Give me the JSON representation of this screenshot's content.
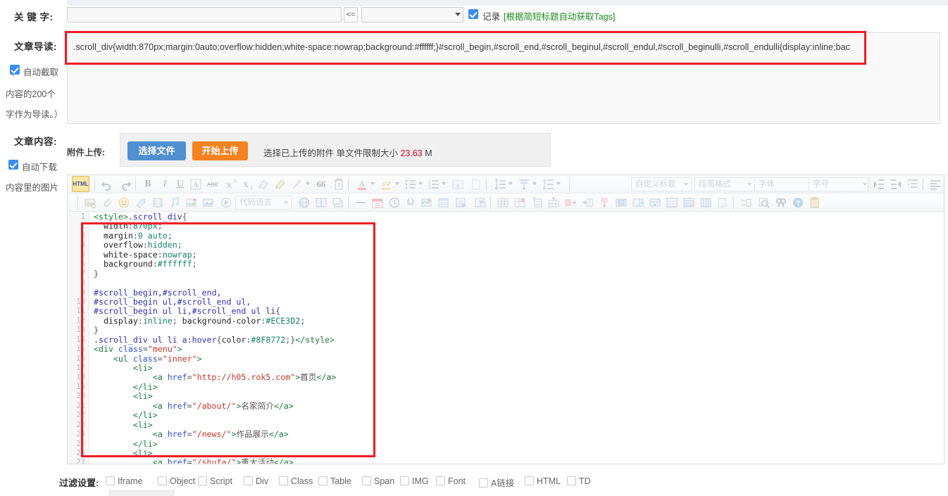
{
  "form": {
    "keywords": {
      "label": "关 键 字:",
      "value": "",
      "placeholder": "",
      "le_button": "<=",
      "select_value": "",
      "record_label": "记录",
      "record_checked": true,
      "tags_hint": "[根据简短标题自动获取Tags]",
      "tags_hint_color": "#1a8a1a"
    },
    "summary": {
      "label": "文章导读:",
      "value": ".scroll_div{width:870px;margin:0auto;overflow:hidden;white-space:nowrap;background:#ffffff;}#scroll_begin,#scroll_end,#scroll_beginul,#scroll_endul,#scroll_beginulli,#scroll_endulli{display:inline;bac",
      "auto_excerpt_label": "自动截取",
      "auto_excerpt_checked": true,
      "hint_line1": "内容的200个",
      "hint_line2": "字作为导读。）",
      "paren_open": "（"
    },
    "content": {
      "label": "文章内容:",
      "auto_download_label": "自动下载",
      "auto_download_checked": true,
      "hint_line1": "内容里的图片"
    },
    "upload": {
      "label": "附件上传:",
      "choose_file": "选择文件",
      "start_upload": "开始上传",
      "hint_prefix": "选择已上传的附件 单文件限制大小 ",
      "size_value": "23.63",
      "size_unit": " M",
      "size_color": "#d0021b"
    },
    "filter": {
      "label": "过滤设置:",
      "options": [
        {
          "label": "Iframe",
          "checked": false
        },
        {
          "label": "Object",
          "checked": false
        },
        {
          "label": "Script",
          "checked": false
        },
        {
          "label": "Div",
          "checked": false
        },
        {
          "label": "Class",
          "checked": false
        },
        {
          "label": "Table",
          "checked": false
        },
        {
          "label": "Span",
          "checked": false
        },
        {
          "label": "IMG",
          "checked": false
        },
        {
          "label": "Font",
          "checked": false
        },
        {
          "label": "A链接",
          "checked": false
        },
        {
          "label": "HTML",
          "checked": false
        },
        {
          "label": "TD",
          "checked": false
        }
      ]
    }
  },
  "editor": {
    "toolbar_row1": {
      "source_button": "HTML",
      "icons": [
        "html-source-icon",
        "undo-icon",
        "redo-icon",
        "bold-icon",
        "italic-icon",
        "underline-icon",
        "text-border-icon",
        "strikethrough-icon",
        "superscript-icon",
        "subscript-icon",
        "eraser-icon",
        "format-painter-icon",
        "magic-wand-icon",
        "blockquote-icon",
        "paste-text-icon",
        "font-color-icon",
        "highlight-color-icon",
        "unordered-list-icon",
        "ordered-list-icon",
        "anchor-icon",
        "page-break-icon",
        "line-height-icon",
        "paragraph-spacing-icon",
        "vertical-align-icon",
        "indent-right-icon",
        "indent-left-icon",
        "indent-icon",
        "align-left-icon",
        "align-center-icon",
        "align-right-icon",
        "align-justify-icon",
        "spell-check-icon"
      ],
      "selects": [
        {
          "name": "custom-title-select",
          "placeholder": "自定义标题"
        },
        {
          "name": "paragraph-format-select",
          "placeholder": "段落格式"
        },
        {
          "name": "font-family-select",
          "placeholder": "字体"
        },
        {
          "name": "font-size-select",
          "placeholder": "字号"
        }
      ]
    },
    "toolbar_row2": {
      "code_language_placeholder": "代码语言",
      "icons": [
        "insert-image-icon",
        "attachment-icon",
        "emoji-icon",
        "background-icon",
        "video-icon",
        "music-icon",
        "image-gallery-icon",
        "image-map-icon",
        "flash-icon",
        "webapp-icon",
        "split-layout-icon",
        "screenshot-icon",
        "horizontal-rule-icon",
        "calendar-icon",
        "time-icon",
        "omega-special-char-icon",
        "map-icon",
        "template-icon",
        "page-template-icon",
        "word-import-icon",
        "insert-table-icon",
        "delete-table-icon",
        "table-title-icon",
        "insert-row-icon",
        "insert-col-left-icon",
        "insert-col-right-icon",
        "merge-down-icon",
        "merge-cells-icon",
        "split-horizontal-icon",
        "split-vertical-icon",
        "table-border-icon",
        "table-full-border-icon",
        "table-columns-icon",
        "table-sort-icon",
        "scale-icon",
        "search-replace-icon",
        "fullscreen-icon",
        "help-icon",
        "clipboard-icon"
      ]
    },
    "code": {
      "line_count": 27,
      "lines": [
        {
          "n": 1,
          "tokens": [
            {
              "t": "tag",
              "v": "<style>"
            },
            {
              "t": "sel",
              "v": ".scroll_div"
            },
            {
              "t": "punc",
              "v": "{"
            }
          ]
        },
        {
          "n": 2,
          "tokens": [
            {
              "t": "prop",
              "v": "  width"
            },
            {
              "t": "punc",
              "v": ":"
            },
            {
              "t": "val",
              "v": "870px"
            },
            {
              "t": "punc",
              "v": ";"
            }
          ]
        },
        {
          "n": 3,
          "tokens": [
            {
              "t": "prop",
              "v": "  margin"
            },
            {
              "t": "punc",
              "v": ":"
            },
            {
              "t": "val",
              "v": "0 auto"
            },
            {
              "t": "punc",
              "v": ";"
            }
          ]
        },
        {
          "n": 4,
          "tokens": [
            {
              "t": "prop",
              "v": "  overflow"
            },
            {
              "t": "punc",
              "v": ":"
            },
            {
              "t": "val",
              "v": "hidden"
            },
            {
              "t": "punc",
              "v": ";"
            }
          ]
        },
        {
          "n": 5,
          "tokens": [
            {
              "t": "prop",
              "v": "  white-space"
            },
            {
              "t": "punc",
              "v": ":"
            },
            {
              "t": "val",
              "v": "nowrap"
            },
            {
              "t": "punc",
              "v": ";"
            }
          ]
        },
        {
          "n": 6,
          "tokens": [
            {
              "t": "prop",
              "v": "  background"
            },
            {
              "t": "punc",
              "v": ":"
            },
            {
              "t": "val",
              "v": "#ffffff"
            },
            {
              "t": "punc",
              "v": ";"
            }
          ]
        },
        {
          "n": 7,
          "tokens": [
            {
              "t": "punc",
              "v": "}"
            }
          ]
        },
        {
          "n": 8,
          "tokens": []
        },
        {
          "n": 9,
          "tokens": [
            {
              "t": "sel",
              "v": "#scroll_begin,#scroll_end,"
            }
          ]
        },
        {
          "n": 10,
          "tokens": [
            {
              "t": "sel",
              "v": "#scroll_begin ul,#scroll_end ul,"
            }
          ]
        },
        {
          "n": 11,
          "tokens": [
            {
              "t": "sel",
              "v": "#scroll_begin ul li,#scroll_end ul li"
            },
            {
              "t": "punc",
              "v": "{"
            }
          ]
        },
        {
          "n": 12,
          "tokens": [
            {
              "t": "prop",
              "v": "  display"
            },
            {
              "t": "punc",
              "v": ":"
            },
            {
              "t": "val",
              "v": "inline"
            },
            {
              "t": "punc",
              "v": "; "
            },
            {
              "t": "prop",
              "v": "background-color"
            },
            {
              "t": "punc",
              "v": ":"
            },
            {
              "t": "val",
              "v": "#ECE3D2"
            },
            {
              "t": "punc",
              "v": ";"
            }
          ]
        },
        {
          "n": 13,
          "tokens": [
            {
              "t": "punc",
              "v": "}"
            }
          ]
        },
        {
          "n": 14,
          "tokens": [
            {
              "t": "sel",
              "v": ".scroll_div ul li a:hover"
            },
            {
              "t": "punc",
              "v": "{"
            },
            {
              "t": "prop",
              "v": "color"
            },
            {
              "t": "punc",
              "v": ":"
            },
            {
              "t": "val",
              "v": "#8F8772"
            },
            {
              "t": "punc",
              "v": ";}"
            },
            {
              "t": "tag",
              "v": "</style>"
            }
          ]
        },
        {
          "n": 15,
          "tokens": [
            {
              "t": "tag",
              "v": "<div "
            },
            {
              "t": "attr",
              "v": "class"
            },
            {
              "t": "punc",
              "v": "="
            },
            {
              "t": "str",
              "v": "\"menu\""
            },
            {
              "t": "tag",
              "v": ">"
            }
          ]
        },
        {
          "n": 16,
          "tokens": [
            {
              "t": "tag",
              "v": "    <ul "
            },
            {
              "t": "attr",
              "v": "class"
            },
            {
              "t": "punc",
              "v": "="
            },
            {
              "t": "str",
              "v": "\"inner\""
            },
            {
              "t": "tag",
              "v": ">"
            }
          ]
        },
        {
          "n": 17,
          "tokens": [
            {
              "t": "tag",
              "v": "        <li>"
            }
          ]
        },
        {
          "n": 18,
          "tokens": [
            {
              "t": "tag",
              "v": "            <a "
            },
            {
              "t": "attr",
              "v": "href"
            },
            {
              "t": "punc",
              "v": "="
            },
            {
              "t": "str",
              "v": "\"http://h05.rok5.com\""
            },
            {
              "t": "tag",
              "v": ">"
            },
            {
              "t": "txt",
              "v": "首页"
            },
            {
              "t": "tag",
              "v": "</a>"
            }
          ]
        },
        {
          "n": 19,
          "tokens": [
            {
              "t": "tag",
              "v": "        </li>"
            }
          ]
        },
        {
          "n": 20,
          "tokens": [
            {
              "t": "tag",
              "v": "        <li>"
            }
          ]
        },
        {
          "n": 21,
          "tokens": [
            {
              "t": "tag",
              "v": "            <a "
            },
            {
              "t": "attr",
              "v": "href"
            },
            {
              "t": "punc",
              "v": "="
            },
            {
              "t": "str",
              "v": "\"/about/\""
            },
            {
              "t": "tag",
              "v": ">"
            },
            {
              "t": "txt",
              "v": "名家简介"
            },
            {
              "t": "tag",
              "v": "</a>"
            }
          ]
        },
        {
          "n": 22,
          "tokens": [
            {
              "t": "tag",
              "v": "        </li>"
            }
          ]
        },
        {
          "n": 23,
          "tokens": [
            {
              "t": "tag",
              "v": "        <li>"
            }
          ]
        },
        {
          "n": 24,
          "tokens": [
            {
              "t": "tag",
              "v": "            <a "
            },
            {
              "t": "attr",
              "v": "href"
            },
            {
              "t": "punc",
              "v": "="
            },
            {
              "t": "str",
              "v": "\"/news/\""
            },
            {
              "t": "tag",
              "v": ">"
            },
            {
              "t": "txt",
              "v": "作品展示"
            },
            {
              "t": "tag",
              "v": "</a>"
            }
          ]
        },
        {
          "n": 25,
          "tokens": [
            {
              "t": "tag",
              "v": "        </li>"
            }
          ]
        },
        {
          "n": 26,
          "tokens": [
            {
              "t": "tag",
              "v": "        <li>"
            }
          ]
        },
        {
          "n": 27,
          "tokens": [
            {
              "t": "tag",
              "v": "            <a "
            },
            {
              "t": "attr",
              "v": "href"
            },
            {
              "t": "punc",
              "v": "="
            },
            {
              "t": "str",
              "v": "\"/shufa/\""
            },
            {
              "t": "tag",
              "v": ">"
            },
            {
              "t": "txt",
              "v": "重大活动"
            },
            {
              "t": "tag",
              "v": "</a>"
            }
          ]
        }
      ]
    }
  },
  "annotations": {
    "highlight_color": "#ee1c25",
    "boxes": [
      "summary-field-highlight",
      "code-content-highlight"
    ]
  }
}
